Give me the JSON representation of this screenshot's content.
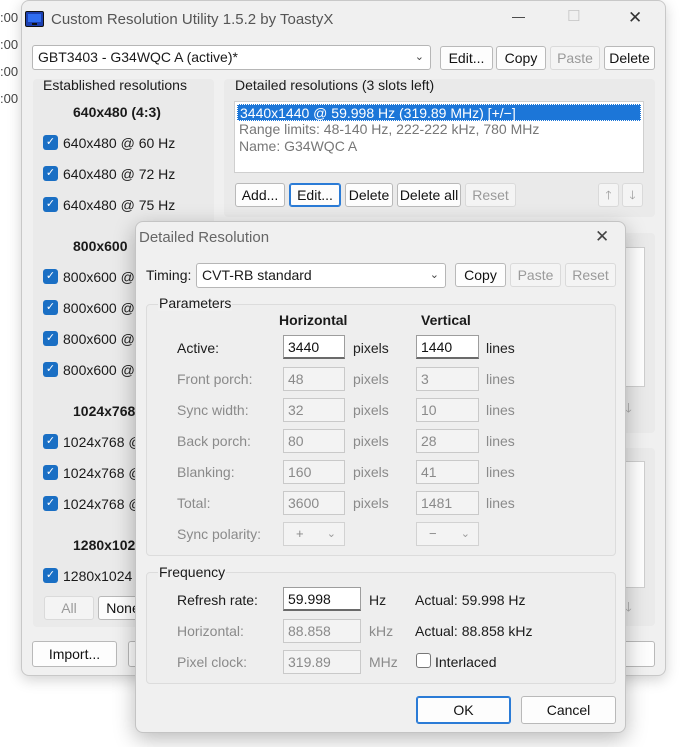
{
  "background_edge": [
    ":00",
    ":00",
    ":00",
    ":00"
  ],
  "window": {
    "title": "Custom Resolution Utility 1.5.2 by ToastyX",
    "controls": {
      "minimize": "—",
      "maximize": "☐",
      "close": "✕"
    }
  },
  "monitor": {
    "selected": "GBT3403 - G34WQC A (active)*",
    "buttons": {
      "edit": "Edit...",
      "copy": "Copy",
      "paste": "Paste",
      "delete": "Delete"
    }
  },
  "established": {
    "title": "Established resolutions",
    "groups": [
      {
        "header": "640x480 (4:3)",
        "items": [
          "640x480 @ 60 Hz",
          "640x480 @ 72 Hz",
          "640x480 @ 75 Hz"
        ]
      },
      {
        "header": "800x600",
        "items": [
          "800x600 @",
          "800x600 @",
          "800x600 @",
          "800x600 @"
        ]
      },
      {
        "header": "1024x768",
        "items": [
          "1024x768 @",
          "1024x768 @",
          "1024x768 @"
        ]
      },
      {
        "header": "1280x102",
        "items": [
          "1280x1024"
        ]
      }
    ],
    "all_label": "All",
    "none_label": "None"
  },
  "detailed": {
    "title": "Detailed resolutions (3 slots left)",
    "items": [
      "3440x1440 @ 59.998 Hz (319.89 MHz) [+/−]",
      "Range limits: 48-140 Hz, 222-222 kHz, 780 MHz",
      "Name: G34WQC A"
    ],
    "buttons": {
      "add": "Add...",
      "edit": "Edit...",
      "delete": "Delete",
      "delete_all": "Delete all",
      "reset": "Reset"
    },
    "up": "🡑",
    "down": "🡓"
  },
  "import_label": "Import...",
  "dialog": {
    "title": "Detailed Resolution",
    "timing_label": "Timing:",
    "timing_value": "CVT-RB standard",
    "buttons": {
      "copy": "Copy",
      "paste": "Paste",
      "reset": "Reset",
      "ok": "OK",
      "cancel": "Cancel"
    },
    "parameters": {
      "title": "Parameters",
      "col_h": "Horizontal",
      "col_v": "Vertical",
      "h_unit": "pixels",
      "v_unit": "lines",
      "rows": [
        {
          "label": "Active:",
          "h": "3440",
          "v": "1440"
        },
        {
          "label": "Front porch:",
          "h": "48",
          "v": "3"
        },
        {
          "label": "Sync width:",
          "h": "32",
          "v": "10"
        },
        {
          "label": "Back porch:",
          "h": "80",
          "v": "28"
        },
        {
          "label": "Blanking:",
          "h": "160",
          "v": "41"
        },
        {
          "label": "Total:",
          "h": "3600",
          "v": "1481"
        }
      ],
      "sync_polarity": {
        "label": "Sync polarity:",
        "h": "+",
        "v": "−"
      }
    },
    "frequency": {
      "title": "Frequency",
      "refresh": {
        "label": "Refresh rate:",
        "value": "59.998",
        "unit": "Hz",
        "actual": "Actual: 59.998 Hz"
      },
      "horizontal": {
        "label": "Horizontal:",
        "value": "88.858",
        "unit": "kHz",
        "actual": "Actual: 88.858 kHz"
      },
      "pixel_clock": {
        "label": "Pixel clock:",
        "value": "319.89",
        "unit": "MHz"
      },
      "interlaced": "Interlaced"
    }
  },
  "colors": {
    "accent": "#1c76d8",
    "checkbox": "#1a6fc4"
  }
}
